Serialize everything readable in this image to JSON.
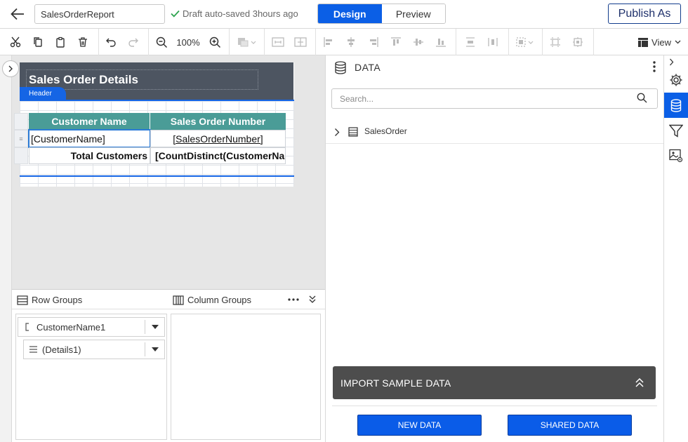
{
  "header": {
    "report_name": "SalesOrderReport",
    "autosave_status": "Draft auto-saved 3hours ago",
    "tabs": [
      {
        "label": "Design",
        "active": true
      },
      {
        "label": "Preview",
        "active": false
      }
    ],
    "publish_label": "Publish As"
  },
  "toolbar": {
    "zoom": "100%",
    "view_label": "View"
  },
  "report": {
    "title": "Sales Order Details",
    "header_tag": "Header",
    "columns": [
      "Customer Name",
      "Sales Order Number"
    ],
    "details_row": [
      "[CustomerName]",
      "[SalesOrderNumber]"
    ],
    "total_row": [
      "Total Customers",
      "[CountDistinct(CustomerName)]"
    ]
  },
  "groups": {
    "row_groups_label": "Row Groups",
    "column_groups_label": "Column Groups",
    "row_groups": [
      "CustomerName1",
      "(Details1)"
    ]
  },
  "data_panel": {
    "title": "DATA",
    "search_placeholder": "Search...",
    "datasets": [
      "SalesOrder"
    ],
    "import_label": "IMPORT SAMPLE DATA",
    "new_data_label": "NEW DATA",
    "shared_data_label": "SHARED DATA"
  },
  "colors": {
    "accent": "#0b5fe6",
    "header_band": "#4d5561",
    "table_header": "#4a9c97",
    "import_bar": "#4d4d4d"
  }
}
